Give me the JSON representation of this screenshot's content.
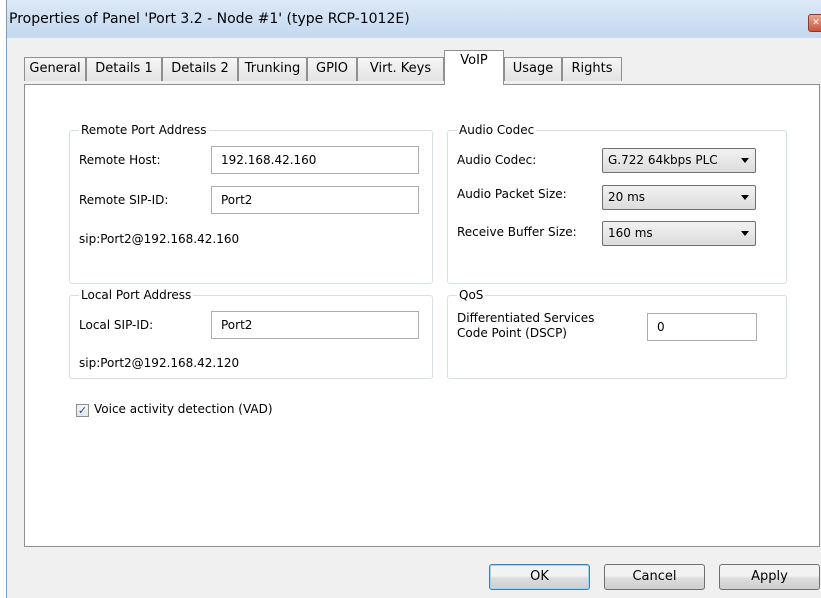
{
  "window": {
    "title": "Properties of Panel 'Port 3.2 - Node #1' (type RCP-1012E)",
    "close_glyph": "✕"
  },
  "tabs": [
    "General",
    "Details 1",
    "Details 2",
    "Trunking",
    "GPIO",
    "Virt. Keys",
    "VoIP",
    "Usage",
    "Rights"
  ],
  "active_tab": "VoIP",
  "remote_port": {
    "legend": "Remote Port Address",
    "host_label": "Remote Host:",
    "host_value": "192.168.42.160",
    "sip_label": "Remote SIP-ID:",
    "sip_value": "Port2",
    "uri": "sip:Port2@192.168.42.160"
  },
  "local_port": {
    "legend": "Local Port Address",
    "sip_label": "Local SIP-ID:",
    "sip_value": "Port2",
    "uri": "sip:Port2@192.168.42.120"
  },
  "audio_codec": {
    "legend": "Audio Codec",
    "codec_label": "Audio Codec:",
    "codec_value": "G.722 64kbps PLC",
    "packet_label": "Audio Packet Size:",
    "packet_value": "20 ms",
    "buffer_label": "Receive Buffer Size:",
    "buffer_value": "160 ms"
  },
  "qos": {
    "legend": "QoS",
    "dscp_label_line1": "Differentiated Services",
    "dscp_label_line2": "Code Point (DSCP)",
    "dscp_value": "0"
  },
  "vad": {
    "label": "Voice activity detection (VAD)",
    "checked": true,
    "check_glyph": "✓"
  },
  "buttons": {
    "ok": "OK",
    "cancel": "Cancel",
    "apply": "Apply"
  },
  "colors": {
    "title_bar": "#dce9f7",
    "default_button_border": "#3c7fb1",
    "close_button": "#c9543a"
  }
}
